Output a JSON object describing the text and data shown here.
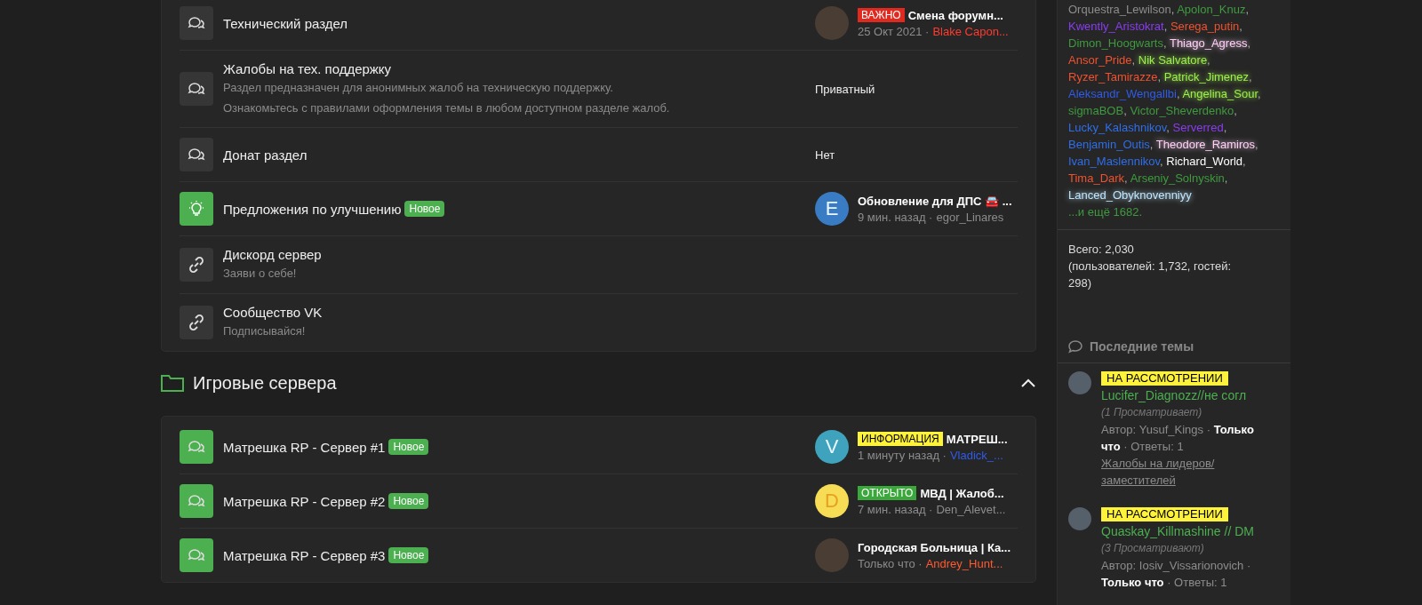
{
  "forums_top": [
    {
      "kind": "chat",
      "unread": false,
      "title": "Технический раздел",
      "is_new": false,
      "last": {
        "kind": "post",
        "avatar": {
          "kind": "photo"
        },
        "prefix": {
          "label": "ВАЖНО",
          "color": "#e0291f"
        },
        "title": "Смена форумн...",
        "date": "25 Окт 2021 ·",
        "author": {
          "name": "Blake Capon...",
          "color": "#ff3b2f"
        }
      }
    },
    {
      "kind": "chat",
      "unread": false,
      "title": "Жалобы на тех. поддержку",
      "description": [
        "Раздел предназначен для анонимных жалоб на техническую поддержку.",
        "Ознакомьтесь с правилами оформления темы в любом доступном разделе жалоб."
      ],
      "is_new": false,
      "last": {
        "kind": "status",
        "text": "Приватный"
      }
    },
    {
      "kind": "chat",
      "unread": false,
      "title": "Донат раздел",
      "is_new": false,
      "last": {
        "kind": "status",
        "text": "Нет"
      }
    },
    {
      "kind": "bulb",
      "unread": true,
      "title": "Предложения по улучшению",
      "is_new": true,
      "new_label": "Новое",
      "last": {
        "kind": "post",
        "avatar": {
          "kind": "letter",
          "letter": "E",
          "color": "#3a7cc4"
        },
        "title": "Обновление для ДПС 🚘 ...",
        "date": "9 мин. назад ·",
        "author": {
          "name": "egor_Linares",
          "color": "#8c8c8c"
        }
      }
    },
    {
      "kind": "link",
      "unread": false,
      "title": "Дискорд сервер",
      "description": [
        "Заяви о себе!"
      ],
      "is_new": false,
      "last": {
        "kind": "none"
      }
    },
    {
      "kind": "link",
      "unread": false,
      "title": "Сообщество VK",
      "description": [
        "Подписывайся!"
      ],
      "is_new": false,
      "last": {
        "kind": "none"
      }
    }
  ],
  "category": {
    "title": "Игровые сервера",
    "expanded": true
  },
  "forums_servers": [
    {
      "kind": "chat",
      "unread": true,
      "title": "Матрешка RP - Сервер #1",
      "is_new": true,
      "new_label": "Новое",
      "last": {
        "kind": "post",
        "avatar": {
          "kind": "letter",
          "letter": "V",
          "color": "#3fa3bd"
        },
        "prefix": {
          "label": "ИНФОРМАЦИЯ",
          "color": "#fff23a"
        },
        "title": "МАТРЕШ...",
        "date": "1 минуту назад ·",
        "author": {
          "name": "Vladick_...",
          "color": "#2f5be8"
        }
      }
    },
    {
      "kind": "chat",
      "unread": true,
      "title": "Матрешка RP - Сервер #2",
      "is_new": true,
      "new_label": "Новое",
      "last": {
        "kind": "post",
        "avatar": {
          "kind": "letter",
          "letter": "D",
          "color": "#f7dc55"
        },
        "prefix": {
          "label": "ОТКРЫТО",
          "color": "#3aa83a"
        },
        "title": "МВД | Жалоб...",
        "date": "7 мин. назад ·",
        "author": {
          "name": "Den_Alevet...",
          "color": "#8c8c8c"
        }
      }
    },
    {
      "kind": "chat",
      "unread": true,
      "title": "Матрешка RP - Сервер #3",
      "is_new": true,
      "new_label": "Новое",
      "last": {
        "kind": "post",
        "avatar": {
          "kind": "photo"
        },
        "title": "Городская Больница | Ка...",
        "date": "Только что ·",
        "author": {
          "name": "Andrey_Hunt...",
          "color": "#ff5a2f"
        }
      }
    }
  ],
  "online": {
    "users": [
      {
        "name": "Orquestra_Lewilson",
        "sep": ",",
        "color": "#8c8c8c",
        "glow": false
      },
      {
        "name": "Apolon_Knuz",
        "sep": ",",
        "color": "#3f9a3f",
        "glow": false
      },
      {
        "name": "Kwently_Aristokrat",
        "sep": ",",
        "color": "#8a3cf0",
        "glow": false
      },
      {
        "name": "Serega_putin",
        "sep": ",",
        "color": "#f0522f",
        "glow": false
      },
      {
        "name": "Dimon_Hoogwarts",
        "sep": ",",
        "color": "#3f9a3f",
        "glow": false
      },
      {
        "name": "Thiago_Agress",
        "sep": ",",
        "color": "#ffd0f5",
        "glow": true
      },
      {
        "name": "Ansor_Pride",
        "sep": ",",
        "color": "#f0522f",
        "glow": false
      },
      {
        "name": "Nik Salvatore",
        "sep": ",",
        "color": "#9cf04a",
        "glow": true
      },
      {
        "name": "Ryzer_Tamirazze",
        "sep": ",",
        "color": "#f0522f",
        "glow": false
      },
      {
        "name": "Patrick_Jimenez",
        "sep": ",",
        "color": "#9cf04a",
        "glow": true
      },
      {
        "name": "Aleksandr_Wengallbi",
        "sep": ",",
        "color": "#2f5be8",
        "glow": false
      },
      {
        "name": "Angelina_Sour",
        "sep": ",",
        "color": "#9cf04a",
        "glow": true
      },
      {
        "name": "sigmaBOB",
        "sep": ",",
        "color": "#3f9a3f",
        "glow": false
      },
      {
        "name": "Victor_Sheverdenko",
        "sep": ",",
        "color": "#3f9a3f",
        "glow": false
      },
      {
        "name": "Lucky_Kalashnikov",
        "sep": ",",
        "color": "#2f6ee8",
        "glow": false
      },
      {
        "name": "Serverred",
        "sep": ",",
        "color": "#8a3cf0",
        "glow": false
      },
      {
        "name": "Benjamin_Outis",
        "sep": ",",
        "color": "#2f6ee8",
        "glow": false
      },
      {
        "name": "Theodore_Ramiros",
        "sep": ",",
        "color": "#ffd0f5",
        "glow": true
      },
      {
        "name": "Ivan_Maslennikov",
        "sep": ",",
        "color": "#2f6ee8",
        "glow": false
      },
      {
        "name": "Richard_World",
        "sep": ",",
        "color": "#ffffff",
        "glow": false
      },
      {
        "name": "Tima_Dark",
        "sep": ",",
        "color": "#f0522f",
        "glow": false
      },
      {
        "name": "Arseniy_Solnyskin",
        "sep": ",",
        "color": "#3f9a3f",
        "glow": false
      },
      {
        "name": "Lanced_Obyknovenniyy",
        "color": "#bfe6ff",
        "glow": true
      }
    ],
    "more": "...и ещё 1682.",
    "total": "Всего: 2,030",
    "breakdown": "(пользователей: 1,732, гостей: 298)"
  },
  "latest": {
    "title": "Последние темы",
    "threads": [
      {
        "prefix": "НА РАССМОТРЕНИИ",
        "title": "Lucifer_Diagnozz//не согл",
        "viewers": "(1 Просматривает)",
        "meta": "Автор: Yusuf_Kings · **Только что** · Ответы: 1",
        "forum": "Жалобы на лидеров/ заместителей"
      },
      {
        "prefix": "НА РАССМОТРЕНИИ",
        "title": "Quaskay_Killmashine // DM",
        "viewers": "(3 Просматривают)",
        "meta": "Автор: Iosiv_Vissarionovich · **Только что** · Ответы: 1"
      }
    ]
  }
}
